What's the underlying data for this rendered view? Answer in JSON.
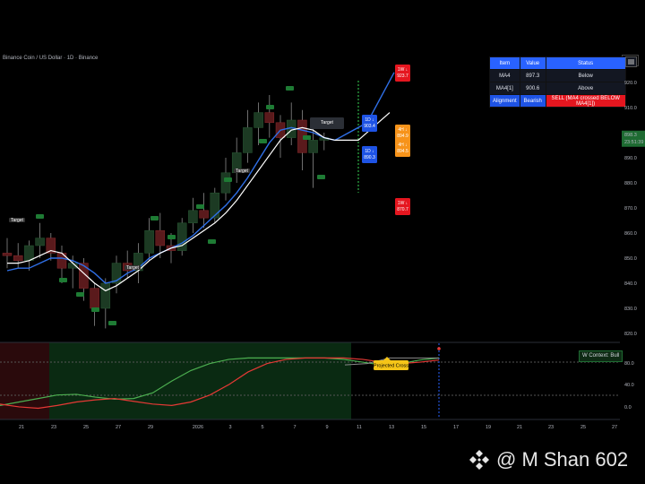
{
  "symbol_title": "Binance Coin / US Dollar · 1D · Binance",
  "currency": "USD",
  "colors": {
    "bull_candle": "#1c3a23",
    "bear_candle": "#5a1a1c",
    "ma_blue": "#2f6fe6",
    "ma_white": "#ffffff",
    "accent_blue": "#2962ff",
    "sell_red": "#e5161f",
    "tag_orange": "#f7931a",
    "tag_green": "#1e7b34",
    "osc_green": "#4caf50",
    "osc_red": "#e53935"
  },
  "status_table": {
    "headers": [
      "Item",
      "Value",
      "Status"
    ],
    "rows": [
      [
        "MA4",
        "897.3",
        "Below"
      ],
      [
        "MA4[1]",
        "900.6",
        "Above"
      ],
      [
        "Alignment",
        "Bearish",
        "SELL (MA4 crossed BELOW MA4[1])"
      ]
    ]
  },
  "price_axis": [
    "920.0",
    "910.0",
    "900.0",
    "890.0",
    "880.0",
    "870.0",
    "860.0",
    "850.0",
    "840.0",
    "830.0",
    "820.0"
  ],
  "current_price": {
    "value": "898.3",
    "timer": "23:51:39"
  },
  "date_axis": [
    "21",
    "23",
    "25",
    "27",
    "29",
    "2026",
    "3",
    "5",
    "7",
    "9",
    "11",
    "13",
    "15",
    "17",
    "19",
    "21",
    "23",
    "25",
    "27"
  ],
  "osc_axis": [
    "80.0",
    "40.0",
    "0.0"
  ],
  "projection_tags": [
    {
      "label": "1W ↓",
      "value": "923.7",
      "color": "red"
    },
    {
      "label": "1D ↓",
      "value": "903.4",
      "color": "blue"
    },
    {
      "label": "4H ↓",
      "value": "894.9",
      "color": "orange"
    },
    {
      "label": "4H ↓",
      "value": "894.5",
      "color": "orange"
    },
    {
      "label": "1D ↓",
      "value": "890.3",
      "color": "blue"
    },
    {
      "label": "1W ↓",
      "value": "870.7",
      "color": "red"
    }
  ],
  "target_label": "Target",
  "projected_cross": "Projected Cross",
  "context_badge": "W Context: Bull",
  "watermark": "@ M Shan 602",
  "chart_data": {
    "type": "candlestick",
    "candles": [
      [
        852,
        858,
        846,
        851
      ],
      [
        851,
        856,
        846,
        849
      ],
      [
        849,
        857,
        845,
        855
      ],
      [
        855,
        864,
        850,
        858
      ],
      [
        858,
        860,
        849,
        852
      ],
      [
        852,
        855,
        840,
        846
      ],
      [
        846,
        851,
        838,
        848
      ],
      [
        848,
        850,
        833,
        838
      ],
      [
        838,
        840,
        823,
        830
      ],
      [
        830,
        842,
        822,
        840
      ],
      [
        840,
        851,
        836,
        848
      ],
      [
        848,
        853,
        842,
        845
      ],
      [
        845,
        856,
        840,
        852
      ],
      [
        852,
        866,
        849,
        861
      ],
      [
        861,
        868,
        850,
        855
      ],
      [
        855,
        860,
        848,
        853
      ],
      [
        853,
        866,
        851,
        864
      ],
      [
        864,
        874,
        860,
        869
      ],
      [
        869,
        876,
        862,
        866
      ],
      [
        866,
        878,
        864,
        876
      ],
      [
        876,
        890,
        873,
        884
      ],
      [
        884,
        898,
        880,
        892
      ],
      [
        892,
        909,
        888,
        902
      ],
      [
        902,
        912,
        895,
        908
      ],
      [
        908,
        915,
        898,
        904
      ],
      [
        904,
        907,
        890,
        898
      ],
      [
        898,
        912,
        895,
        905
      ],
      [
        905,
        909,
        885,
        892
      ],
      [
        892,
        903,
        878,
        897
      ],
      [
        897,
        900,
        893,
        898
      ]
    ],
    "ma_blue": [
      845,
      846,
      846,
      848,
      850,
      850,
      849,
      847,
      844,
      840,
      841,
      844,
      846,
      850,
      852,
      854,
      856,
      859,
      863,
      867,
      871,
      876,
      882,
      889,
      896,
      901,
      902,
      901,
      900,
      898,
      897
    ],
    "ma_white": [
      848,
      848,
      849,
      851,
      853,
      852,
      848,
      844,
      840,
      837,
      839,
      842,
      845,
      849,
      852,
      854,
      855,
      858,
      861,
      864,
      868,
      873,
      879,
      885,
      891,
      897,
      901,
      902,
      901,
      898,
      897
    ],
    "oscillator": {
      "green": [
        20,
        25,
        30,
        35,
        36,
        32,
        29,
        30,
        38,
        55,
        70,
        80,
        86,
        88,
        88,
        88,
        88,
        88,
        86,
        82,
        78,
        80,
        85,
        88
      ],
      "red": [
        22,
        18,
        16,
        20,
        25,
        28,
        30,
        26,
        22,
        20,
        25,
        35,
        50,
        68,
        80,
        86,
        88,
        88,
        88,
        86,
        82,
        80,
        82,
        85
      ]
    }
  }
}
